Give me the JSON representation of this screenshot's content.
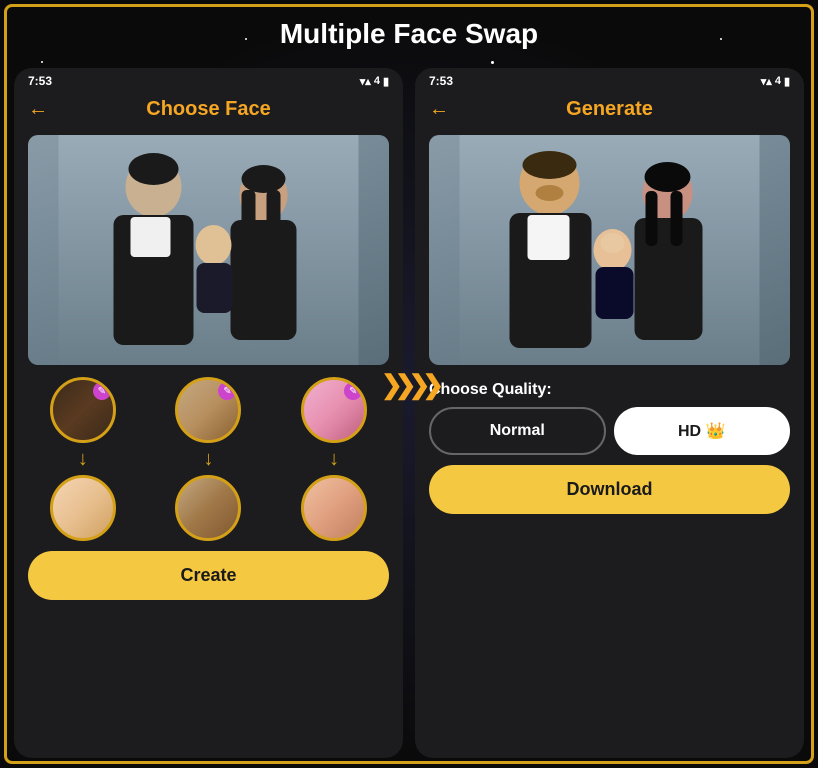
{
  "page": {
    "title": "Multiple Face Swap",
    "background_color": "#0a0a0a",
    "accent_color": "#f5c842"
  },
  "phone_left": {
    "status_bar": {
      "time": "7:53",
      "icons": "▼▲4G🔋"
    },
    "header": {
      "back_label": "←",
      "title": "Choose Face"
    },
    "face_pairs": [
      {
        "source_type": "face-dark",
        "target_type": "face-baby",
        "has_edit": true,
        "edit_icon": "✎"
      },
      {
        "source_type": "face-beard",
        "target_type": "face-man",
        "has_edit": true,
        "edit_icon": "✎"
      },
      {
        "source_type": "face-pink",
        "target_type": "face-woman",
        "has_edit": true,
        "edit_icon": "✎"
      }
    ],
    "create_button": {
      "label": "Create"
    }
  },
  "phone_right": {
    "status_bar": {
      "time": "7:53",
      "icons": "▼▲4G🔋"
    },
    "header": {
      "back_label": "←",
      "title": "Generate"
    },
    "quality": {
      "label": "Choose Quality:",
      "options": [
        {
          "id": "normal",
          "label": "Normal",
          "active": false
        },
        {
          "id": "hd",
          "label": "HD 👑",
          "active": true
        }
      ]
    },
    "download_button": {
      "label": "Download"
    }
  },
  "arrows": {
    "symbol": "❯❯❯❯"
  }
}
